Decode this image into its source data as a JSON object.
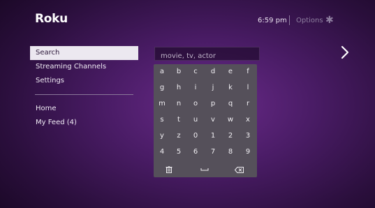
{
  "header": {
    "logo": "Roku",
    "time": "6:59 pm",
    "options_label": "Options",
    "options_icon": "asterisk-icon"
  },
  "menu": {
    "items": [
      {
        "label": "Search"
      },
      {
        "label": "Streaming Channels"
      },
      {
        "label": "Settings"
      }
    ],
    "secondary_items": [
      {
        "label": "Home"
      },
      {
        "label": "My Feed (4)"
      }
    ],
    "active": "Search"
  },
  "search": {
    "placeholder": "movie, tv, actor",
    "value": ""
  },
  "keyboard": {
    "rows": [
      [
        "a",
        "b",
        "c",
        "d",
        "e",
        "f"
      ],
      [
        "g",
        "h",
        "i",
        "j",
        "k",
        "l"
      ],
      [
        "m",
        "n",
        "o",
        "p",
        "q",
        "r"
      ],
      [
        "s",
        "t",
        "u",
        "v",
        "w",
        "x"
      ],
      [
        "y",
        "z",
        "0",
        "1",
        "2",
        "3"
      ],
      [
        "4",
        "5",
        "6",
        "7",
        "8",
        "9"
      ]
    ],
    "special_keys": [
      "delete-icon",
      "space-icon",
      "backspace-icon"
    ]
  },
  "colors": {
    "background": "#3a1550",
    "menu_highlight": "#ece8f0",
    "keyboard": "#55505a"
  }
}
